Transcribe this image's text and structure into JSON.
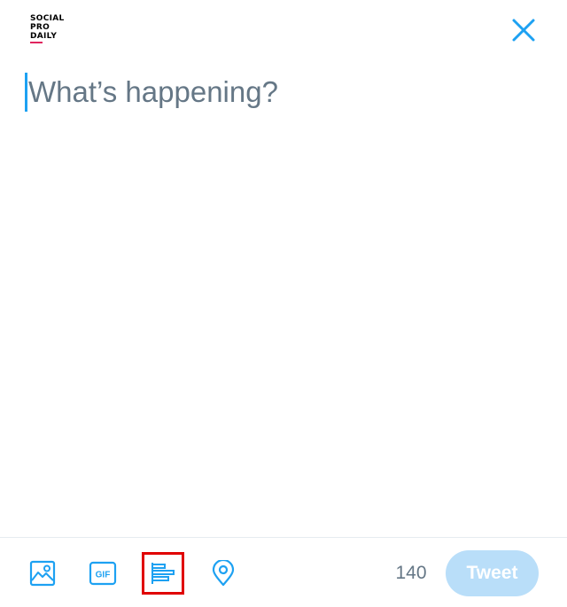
{
  "logo": {
    "lines": [
      "SOCIAL",
      "PRO",
      "DAILY"
    ]
  },
  "compose": {
    "placeholder": "What’s happening?",
    "value": ""
  },
  "toolbar": {
    "media_icon": "image-icon",
    "gif_icon": "gif-icon",
    "gif_label": "GIF",
    "poll_icon": "poll-icon",
    "location_icon": "location-pin-icon",
    "char_count": "140",
    "tweet_label": "Tweet"
  },
  "colors": {
    "accent": "#1da1f2",
    "tweet_button_disabled": "#b9def9",
    "placeholder_text": "#657786",
    "highlight_box": "#e00000"
  }
}
